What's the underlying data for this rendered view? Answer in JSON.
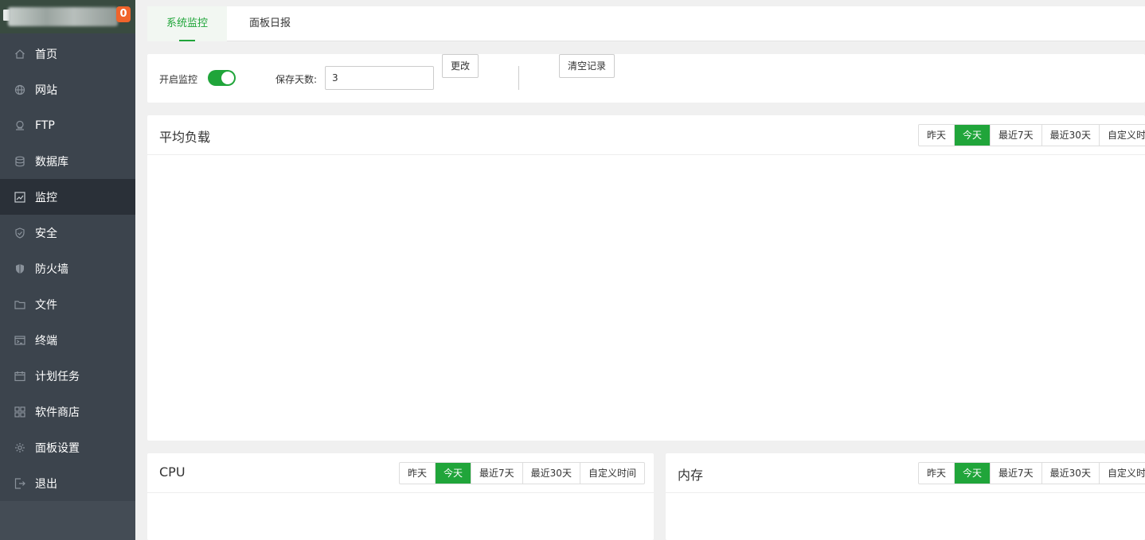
{
  "sidebar": {
    "badge": "0",
    "items": [
      {
        "label": "首页",
        "icon": "home-icon"
      },
      {
        "label": "网站",
        "icon": "globe-icon"
      },
      {
        "label": "FTP",
        "icon": "ftp-icon"
      },
      {
        "label": "数据库",
        "icon": "database-icon"
      },
      {
        "label": "监控",
        "icon": "monitor-icon"
      },
      {
        "label": "安全",
        "icon": "shield-icon"
      },
      {
        "label": "防火墙",
        "icon": "firewall-icon"
      },
      {
        "label": "文件",
        "icon": "folder-icon"
      },
      {
        "label": "终端",
        "icon": "terminal-icon"
      },
      {
        "label": "计划任务",
        "icon": "calendar-icon"
      },
      {
        "label": "软件商店",
        "icon": "apps-icon"
      },
      {
        "label": "面板设置",
        "icon": "gear-icon"
      },
      {
        "label": "退出",
        "icon": "logout-icon"
      }
    ],
    "active_index": 4
  },
  "tabs": [
    {
      "label": "系统监控"
    },
    {
      "label": "面板日报"
    }
  ],
  "settings": {
    "enable_label": "开启监控",
    "enabled": true,
    "days_label": "保存天数:",
    "days_value": "3",
    "change_button": "更改",
    "clear_button": "清空记录"
  },
  "ranges": [
    "昨天",
    "今天",
    "最近7天",
    "最近30天",
    "自定义时间"
  ],
  "active_range": "今天",
  "panels": {
    "load": {
      "title": "平均负载"
    },
    "cpu": {
      "title": "CPU"
    },
    "memory": {
      "title": "内存"
    }
  },
  "colors": {
    "accent": "#20a53a",
    "sidebar_bg": "#3c444d",
    "badge": "#f0642b"
  }
}
